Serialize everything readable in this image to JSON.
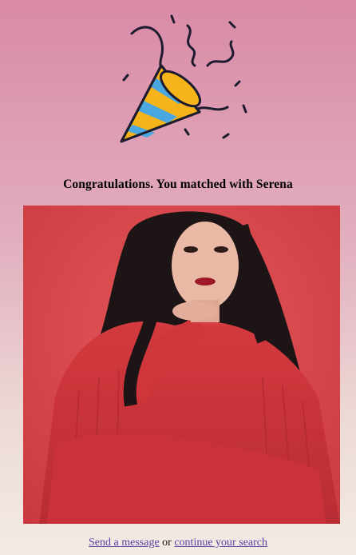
{
  "match": {
    "heading": "Congratulations. You matched with Serena"
  },
  "icons": {
    "celebration": "party-popper-icon"
  },
  "photo": {
    "subject": "profile-photo"
  },
  "footer": {
    "send_message": "Send a message",
    "separator": "or",
    "continue_search": "continue your search"
  },
  "colors": {
    "link": "#5a3fa5",
    "popper_yellow": "#f6b31a",
    "popper_blue": "#4aa7e0",
    "background_top": "#d98aa6",
    "background_bottom": "#f3ebe4"
  }
}
